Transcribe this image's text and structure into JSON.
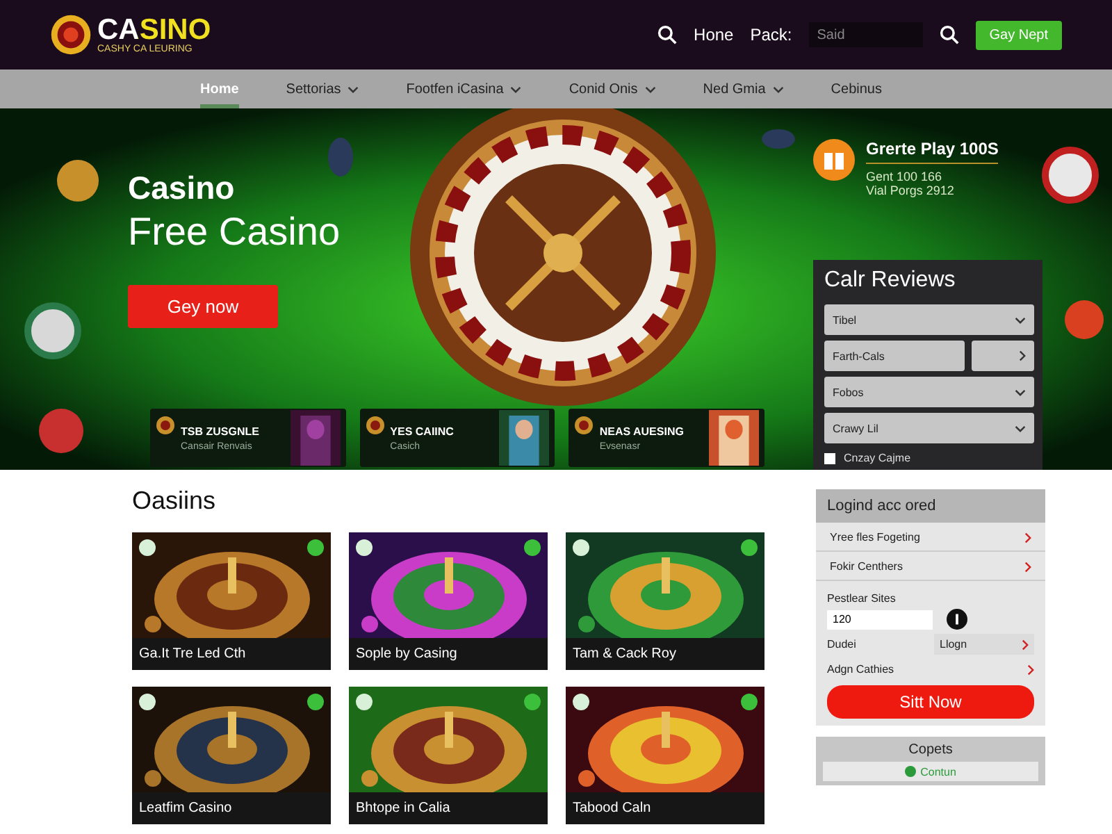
{
  "header": {
    "logo": {
      "title": "CASINO",
      "tagline": "CASHY CA LEURING"
    },
    "links": [
      "Hone",
      "Pack:"
    ],
    "search": {
      "placeholder": "Said"
    },
    "button": "Gay Nept"
  },
  "nav": [
    {
      "label": "Home",
      "selected": true,
      "dropdown": false
    },
    {
      "label": "Settorias",
      "selected": false,
      "dropdown": true
    },
    {
      "label": "Footfen iCasina",
      "selected": false,
      "dropdown": true
    },
    {
      "label": "Conid Onis",
      "selected": false,
      "dropdown": true
    },
    {
      "label": "Ned Gmia",
      "selected": false,
      "dropdown": true
    },
    {
      "label": "Cebinus",
      "selected": false,
      "dropdown": false
    }
  ],
  "hero": {
    "title": "Casino",
    "subtitle": "Free Casino",
    "button": "Gey now",
    "promos": [
      {
        "title": "TSB ZUSGNLE",
        "subtitle": "Cansair Renvais"
      },
      {
        "title": "YES CAIINC",
        "subtitle": "Casich"
      },
      {
        "title": "NEAS AUESING",
        "subtitle": "Evsenasr"
      }
    ]
  },
  "bonus": {
    "title": "Grerte Play 100S",
    "lines": [
      "Gent 100 166",
      "Vial Porgs 2912"
    ]
  },
  "reviews": {
    "title": "Calr Reviews",
    "fields": [
      {
        "kind": "select",
        "label": "Tibel"
      },
      {
        "kind": "split",
        "label": "Farth-Cals"
      },
      {
        "kind": "select",
        "label": "Fobos"
      },
      {
        "kind": "select",
        "label": "Crawy Lil"
      }
    ],
    "checkbox": {
      "label": "Cnzay Cajme",
      "checked": false
    }
  },
  "games": {
    "title": "Oasiins",
    "items": [
      {
        "caption": "Ga.It Tre Led Cth"
      },
      {
        "caption": "Sople by Casing"
      },
      {
        "caption": "Tam & Cack Roy"
      },
      {
        "caption": "Leatfim Casino"
      },
      {
        "caption": "Bhtope in Calia"
      },
      {
        "caption": "Tabood Caln"
      }
    ]
  },
  "login": {
    "title": "Logind acc ored",
    "links": [
      "Yree fles Fogeting",
      "Fokir Centhers"
    ],
    "field": {
      "label": "Pestlear Sites",
      "value": "120"
    },
    "rows": [
      {
        "label": "Dudei",
        "action": "Llogn"
      },
      {
        "label": "Adgn Cathies"
      }
    ],
    "button": "Sitt Now"
  },
  "coupons": {
    "title": "Copets",
    "button": "Contun"
  }
}
